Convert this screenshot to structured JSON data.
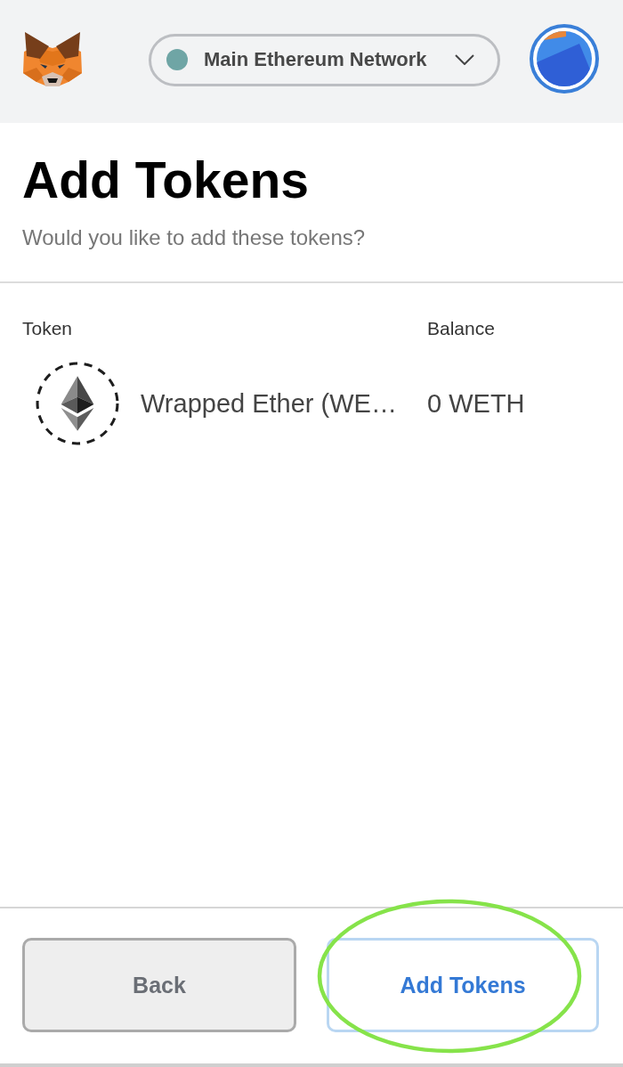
{
  "header": {
    "network": {
      "label": "Main Ethereum Network"
    }
  },
  "page": {
    "title": "Add Tokens",
    "subtitle": "Would you like to add these tokens?"
  },
  "table": {
    "columns": [
      "Token",
      "Balance"
    ],
    "rows": [
      {
        "token": "Wrapped Ether (WE…",
        "balance": "0 WETH"
      }
    ]
  },
  "buttons": [
    {
      "label": "Back",
      "kind": "secondary",
      "highlighted": false
    },
    {
      "label": "Add Tokens",
      "kind": "primary",
      "highlighted": true
    }
  ]
}
